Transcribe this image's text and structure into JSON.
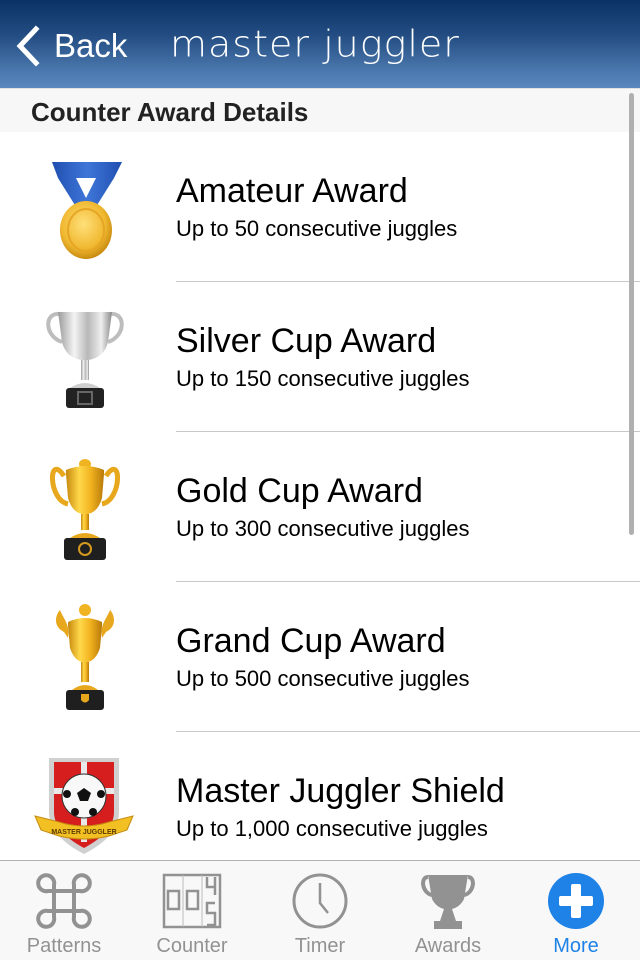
{
  "navbar": {
    "back_label": "Back",
    "title": "master juggler"
  },
  "section": {
    "title": "Counter Award Details"
  },
  "awards": [
    {
      "icon": "medal-icon",
      "title": "Amateur Award",
      "subtitle": "Up to 50 consecutive juggles"
    },
    {
      "icon": "silver-cup-icon",
      "title": "Silver Cup Award",
      "subtitle": "Up to 150 consecutive juggles"
    },
    {
      "icon": "gold-cup-icon",
      "title": "Gold Cup Award",
      "subtitle": "Up to 300 consecutive juggles"
    },
    {
      "icon": "grand-cup-icon",
      "title": "Grand Cup Award",
      "subtitle": "Up to 500 consecutive juggles"
    },
    {
      "icon": "shield-icon",
      "title": "Master Juggler Shield",
      "subtitle": "Up to 1,000 consecutive juggles",
      "badge_text": "MASTER JUGGLER"
    }
  ],
  "tabbar": {
    "tabs": [
      {
        "label": "Patterns",
        "icon": "command-icon",
        "active": false
      },
      {
        "label": "Counter",
        "icon": "counter-icon",
        "active": false,
        "icon_digits": "0045"
      },
      {
        "label": "Timer",
        "icon": "clock-icon",
        "active": false
      },
      {
        "label": "Awards",
        "icon": "trophy-icon",
        "active": false
      },
      {
        "label": "More",
        "icon": "plus-circle-icon",
        "active": true
      }
    ]
  },
  "colors": {
    "accent": "#1e82e6",
    "inactive_tab": "#929292",
    "navbar_top": "#0a3266",
    "navbar_bottom": "#5a87bd"
  }
}
